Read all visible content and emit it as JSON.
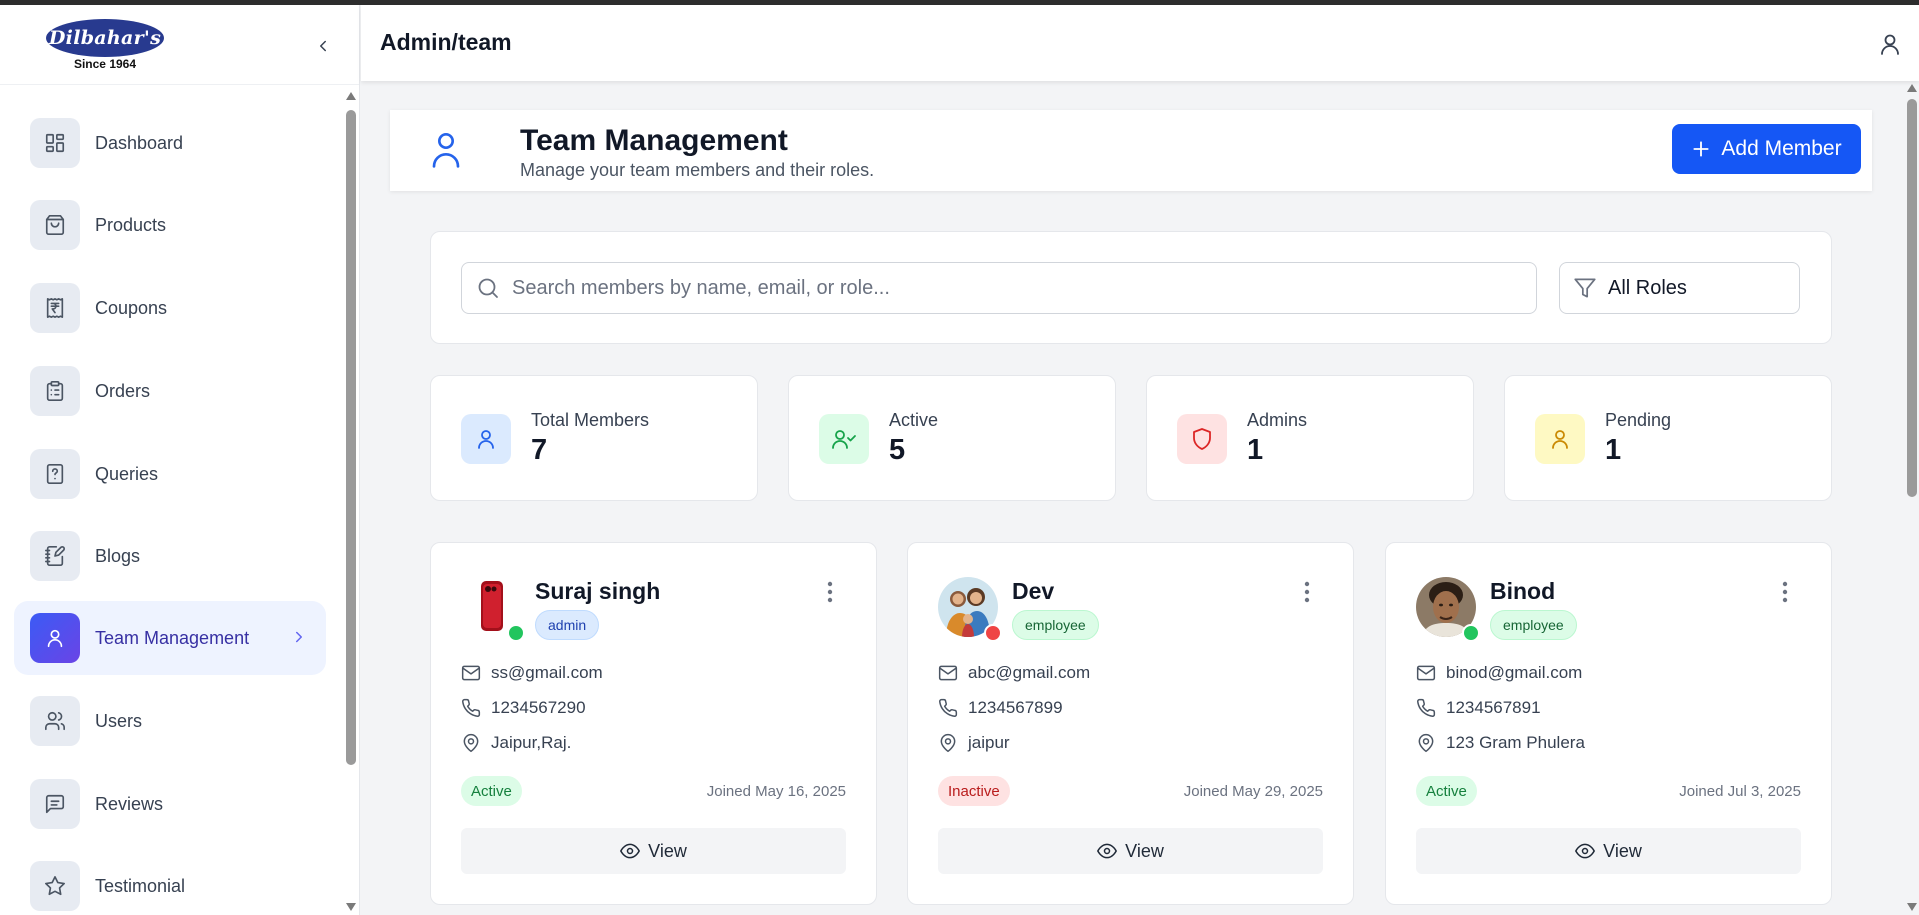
{
  "brand": {
    "logo_text": "Dilbahar's",
    "since": "Since 1964"
  },
  "header": {
    "title": "Admin/team"
  },
  "sidebar": {
    "items": [
      {
        "label": "Dashboard",
        "icon": "dashboard-icon"
      },
      {
        "label": "Products",
        "icon": "shopping-bag-icon"
      },
      {
        "label": "Coupons",
        "icon": "rupee-receipt-icon"
      },
      {
        "label": "Orders",
        "icon": "clipboard-list-icon"
      },
      {
        "label": "Queries",
        "icon": "help-file-icon"
      },
      {
        "label": "Blogs",
        "icon": "notebook-pen-icon"
      },
      {
        "label": "Team Management",
        "icon": "user-icon",
        "active": true
      },
      {
        "label": "Users",
        "icon": "users-icon"
      },
      {
        "label": "Reviews",
        "icon": "message-square-icon"
      },
      {
        "label": "Testimonial",
        "icon": "star-icon"
      }
    ]
  },
  "page": {
    "title": "Team Management",
    "subtitle": "Manage your team members and their roles.",
    "add_button": "Add Member"
  },
  "search": {
    "placeholder": "Search members by name, email, or role...",
    "value": ""
  },
  "filter": {
    "selected": "All Roles"
  },
  "stats": [
    {
      "label": "Total Members",
      "value": "7",
      "icon": "user-icon",
      "bg": "#dbeafe",
      "fg": "#2563eb"
    },
    {
      "label": "Active",
      "value": "5",
      "icon": "user-check-icon",
      "bg": "#dcfce7",
      "fg": "#16a34a"
    },
    {
      "label": "Admins",
      "value": "1",
      "icon": "shield-icon",
      "bg": "#fee2e2",
      "fg": "#dc2626"
    },
    {
      "label": "Pending",
      "value": "1",
      "icon": "user-icon",
      "bg": "#fef9c3",
      "fg": "#ca8a04"
    }
  ],
  "members": [
    {
      "name": "Suraj singh",
      "role": "admin",
      "email": "ss@gmail.com",
      "phone": "1234567290",
      "location": "Jaipur,Raj.",
      "status": "Active",
      "joined": "Joined May 16, 2025",
      "online": true
    },
    {
      "name": "Dev",
      "role": "employee",
      "email": "abc@gmail.com",
      "phone": "1234567899",
      "location": "jaipur",
      "status": "Inactive",
      "joined": "Joined May 29, 2025",
      "online": false
    },
    {
      "name": "Binod",
      "role": "employee",
      "email": "binod@gmail.com",
      "phone": "1234567891",
      "location": "123 Gram Phulera",
      "status": "Active",
      "joined": "Joined Jul 3, 2025",
      "online": true
    }
  ],
  "view_label": "View",
  "colors": {
    "primary": "#1557f5",
    "online": "#22c55e",
    "offline": "#ef4444"
  }
}
